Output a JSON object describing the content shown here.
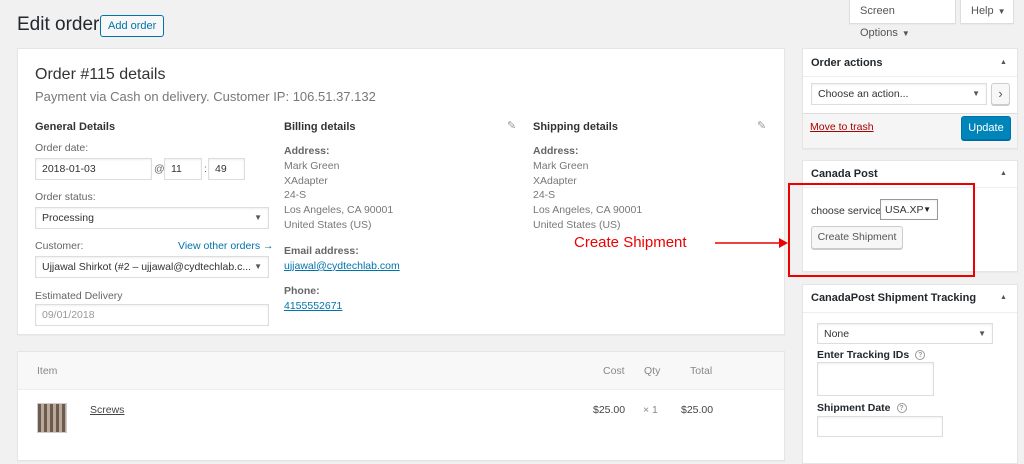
{
  "header": {
    "title": "Edit order",
    "add_order_label": "Add order",
    "screen_options_label": "Screen Options",
    "help_label": "Help"
  },
  "order": {
    "title": "Order #115 details",
    "subtitle": "Payment via Cash on delivery. Customer IP: 106.51.37.132",
    "general": {
      "heading": "General Details",
      "order_date_label": "Order date:",
      "date_value": "2018-01-03",
      "at_symbol": "@",
      "hour_value": "11",
      "minute_value": "49",
      "time_sep": ":",
      "status_label": "Order status:",
      "status_value": "Processing",
      "customer_label": "Customer:",
      "view_other_orders": "View other orders →",
      "customer_value": "Ujjawal Shirkot (#2 – ujjawal@cydtechlab.c...",
      "estimated_label": "Estimated Delivery",
      "estimated_value": "09/01/2018"
    },
    "billing": {
      "heading": "Billing details",
      "address_label": "Address:",
      "address_lines": [
        "Mark Green",
        "XAdapter",
        "24-S",
        "Los Angeles, CA 90001",
        "United States (US)"
      ],
      "email_label": "Email address:",
      "email_value": "ujjawal@cydtechlab.com",
      "phone_label": "Phone:",
      "phone_value": "4155552671"
    },
    "shipping": {
      "heading": "Shipping details",
      "address_label": "Address:",
      "address_lines": [
        "Mark Green",
        "XAdapter",
        "24-S",
        "Los Angeles, CA 90001",
        "United States (US)"
      ]
    }
  },
  "items": {
    "headers": {
      "item": "Item",
      "cost": "Cost",
      "qty": "Qty",
      "total": "Total"
    },
    "rows": [
      {
        "name": "Screws",
        "cost": "$25.00",
        "qty": "× 1",
        "total": "$25.00"
      }
    ]
  },
  "order_actions": {
    "heading": "Order actions",
    "select_value": "Choose an action...",
    "go_label": "›",
    "move_to_trash": "Move to trash",
    "update_label": "Update"
  },
  "canada_post": {
    "heading": "Canada Post",
    "service_label": "choose service:",
    "service_value": "USA.XP",
    "create_button": "Create Shipment"
  },
  "tracking": {
    "heading": "CanadaPost Shipment Tracking",
    "select_value": "None",
    "tracking_ids_label": "Enter Tracking IDs",
    "shipment_date_label": "Shipment Date",
    "help_glyph": "?"
  },
  "annotation": {
    "text": "Create Shipment",
    "color": "#e00000"
  },
  "colors": {
    "accent": "#0073aa",
    "primary_button": "#0085ba",
    "trash": "#aa0000"
  },
  "icons": {
    "pencil": "✎",
    "caret_down": "▼",
    "caret_up": "▲"
  }
}
